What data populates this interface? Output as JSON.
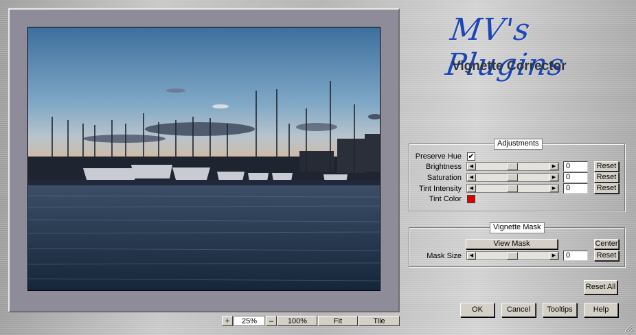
{
  "logo": {
    "script": "MV's Plugins",
    "subtitle": "Vignette Corrector"
  },
  "toolbar": {
    "zoom_in": "+",
    "zoom_value": "25%",
    "zoom_out": "–",
    "zoom_100": "100%",
    "fit": "Fit",
    "tile": "Tile"
  },
  "adjustments": {
    "title": "Adjustments",
    "preserve_hue_label": "Preserve Hue",
    "preserve_hue_checked": "✔",
    "rows": [
      {
        "label": "Brightness",
        "value": "0",
        "reset": "Reset"
      },
      {
        "label": "Saturation",
        "value": "0",
        "reset": "Reset"
      },
      {
        "label": "Tint Intensity",
        "value": "0",
        "reset": "Reset"
      }
    ],
    "tint_color_label": "Tint Color",
    "tint_color": "#e00000"
  },
  "mask": {
    "title": "Vignette Mask",
    "view_mask": "View Mask",
    "center": "Center",
    "mask_size_label": "Mask Size",
    "mask_size_value": "0",
    "reset": "Reset"
  },
  "buttons": {
    "reset_all": "Reset All",
    "ok": "OK",
    "cancel": "Cancel",
    "tooltips": "Tooltips",
    "help": "Help"
  },
  "colors": {
    "logo_blue": "#1b47b8",
    "preview_bg": "#8e8c99"
  }
}
